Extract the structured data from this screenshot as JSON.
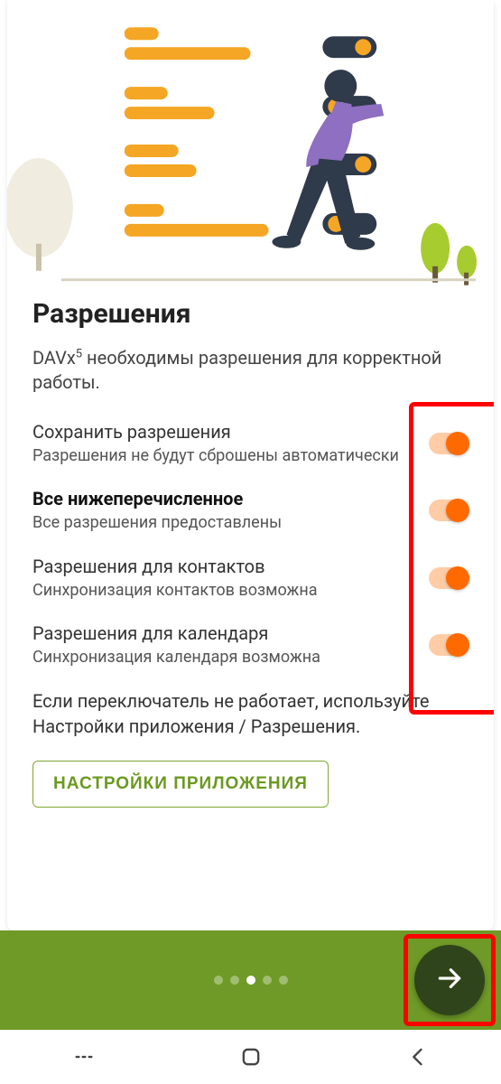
{
  "title": "Разрешения",
  "subtitle_prefix": "DAVx",
  "subtitle_sup": "5",
  "subtitle_rest": " необходимы разрешения для корректной работы.",
  "permissions": [
    {
      "title": "Сохранить разрешения",
      "desc": "Разрешения не будут сброшены автоматически",
      "bold": false,
      "on": true
    },
    {
      "title": "Все нижеперечисленное",
      "desc": "Все разрешения предоставлены",
      "bold": true,
      "on": true
    },
    {
      "title": "Разрешения для контактов",
      "desc": "Синхронизация контактов возможна",
      "bold": false,
      "on": true
    },
    {
      "title": "Разрешения для календаря",
      "desc": "Синхронизация календаря возможна",
      "bold": false,
      "on": true
    }
  ],
  "info_text": "Если переключатель не работает, используйте Настройки приложения / Разрешения.",
  "app_settings_button": "НАСТРОЙКИ ПРИЛОЖЕНИЯ",
  "pager": {
    "count": 5,
    "active": 2
  },
  "colors": {
    "accent": "#ff6a00",
    "green_bar": "#6f9a27",
    "fab": "#2f441a",
    "highlight": "#ff0000"
  }
}
